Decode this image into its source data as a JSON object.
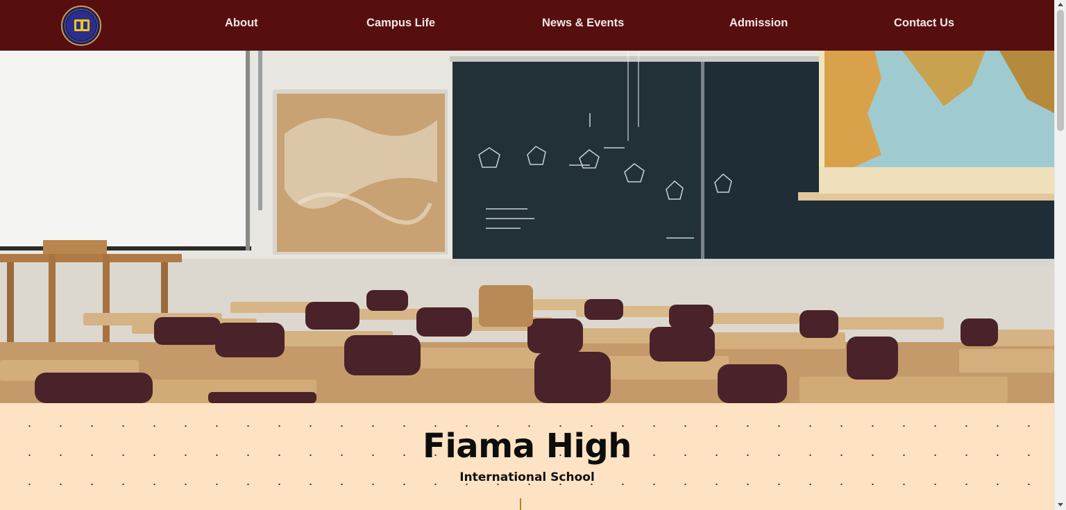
{
  "header": {
    "logo_name": "school-crest-logo",
    "nav": [
      {
        "label": "About"
      },
      {
        "label": "Campus Life"
      },
      {
        "label": "News & Events"
      },
      {
        "label": "Admission"
      },
      {
        "label": "Contact Us"
      }
    ],
    "background_color": "#560e0f"
  },
  "hero": {
    "image": "classroom-photo"
  },
  "intro": {
    "title": "Fiama High",
    "subtitle": "International School",
    "background_color": "#fde3c4",
    "accent_color": "#c77a1f"
  }
}
